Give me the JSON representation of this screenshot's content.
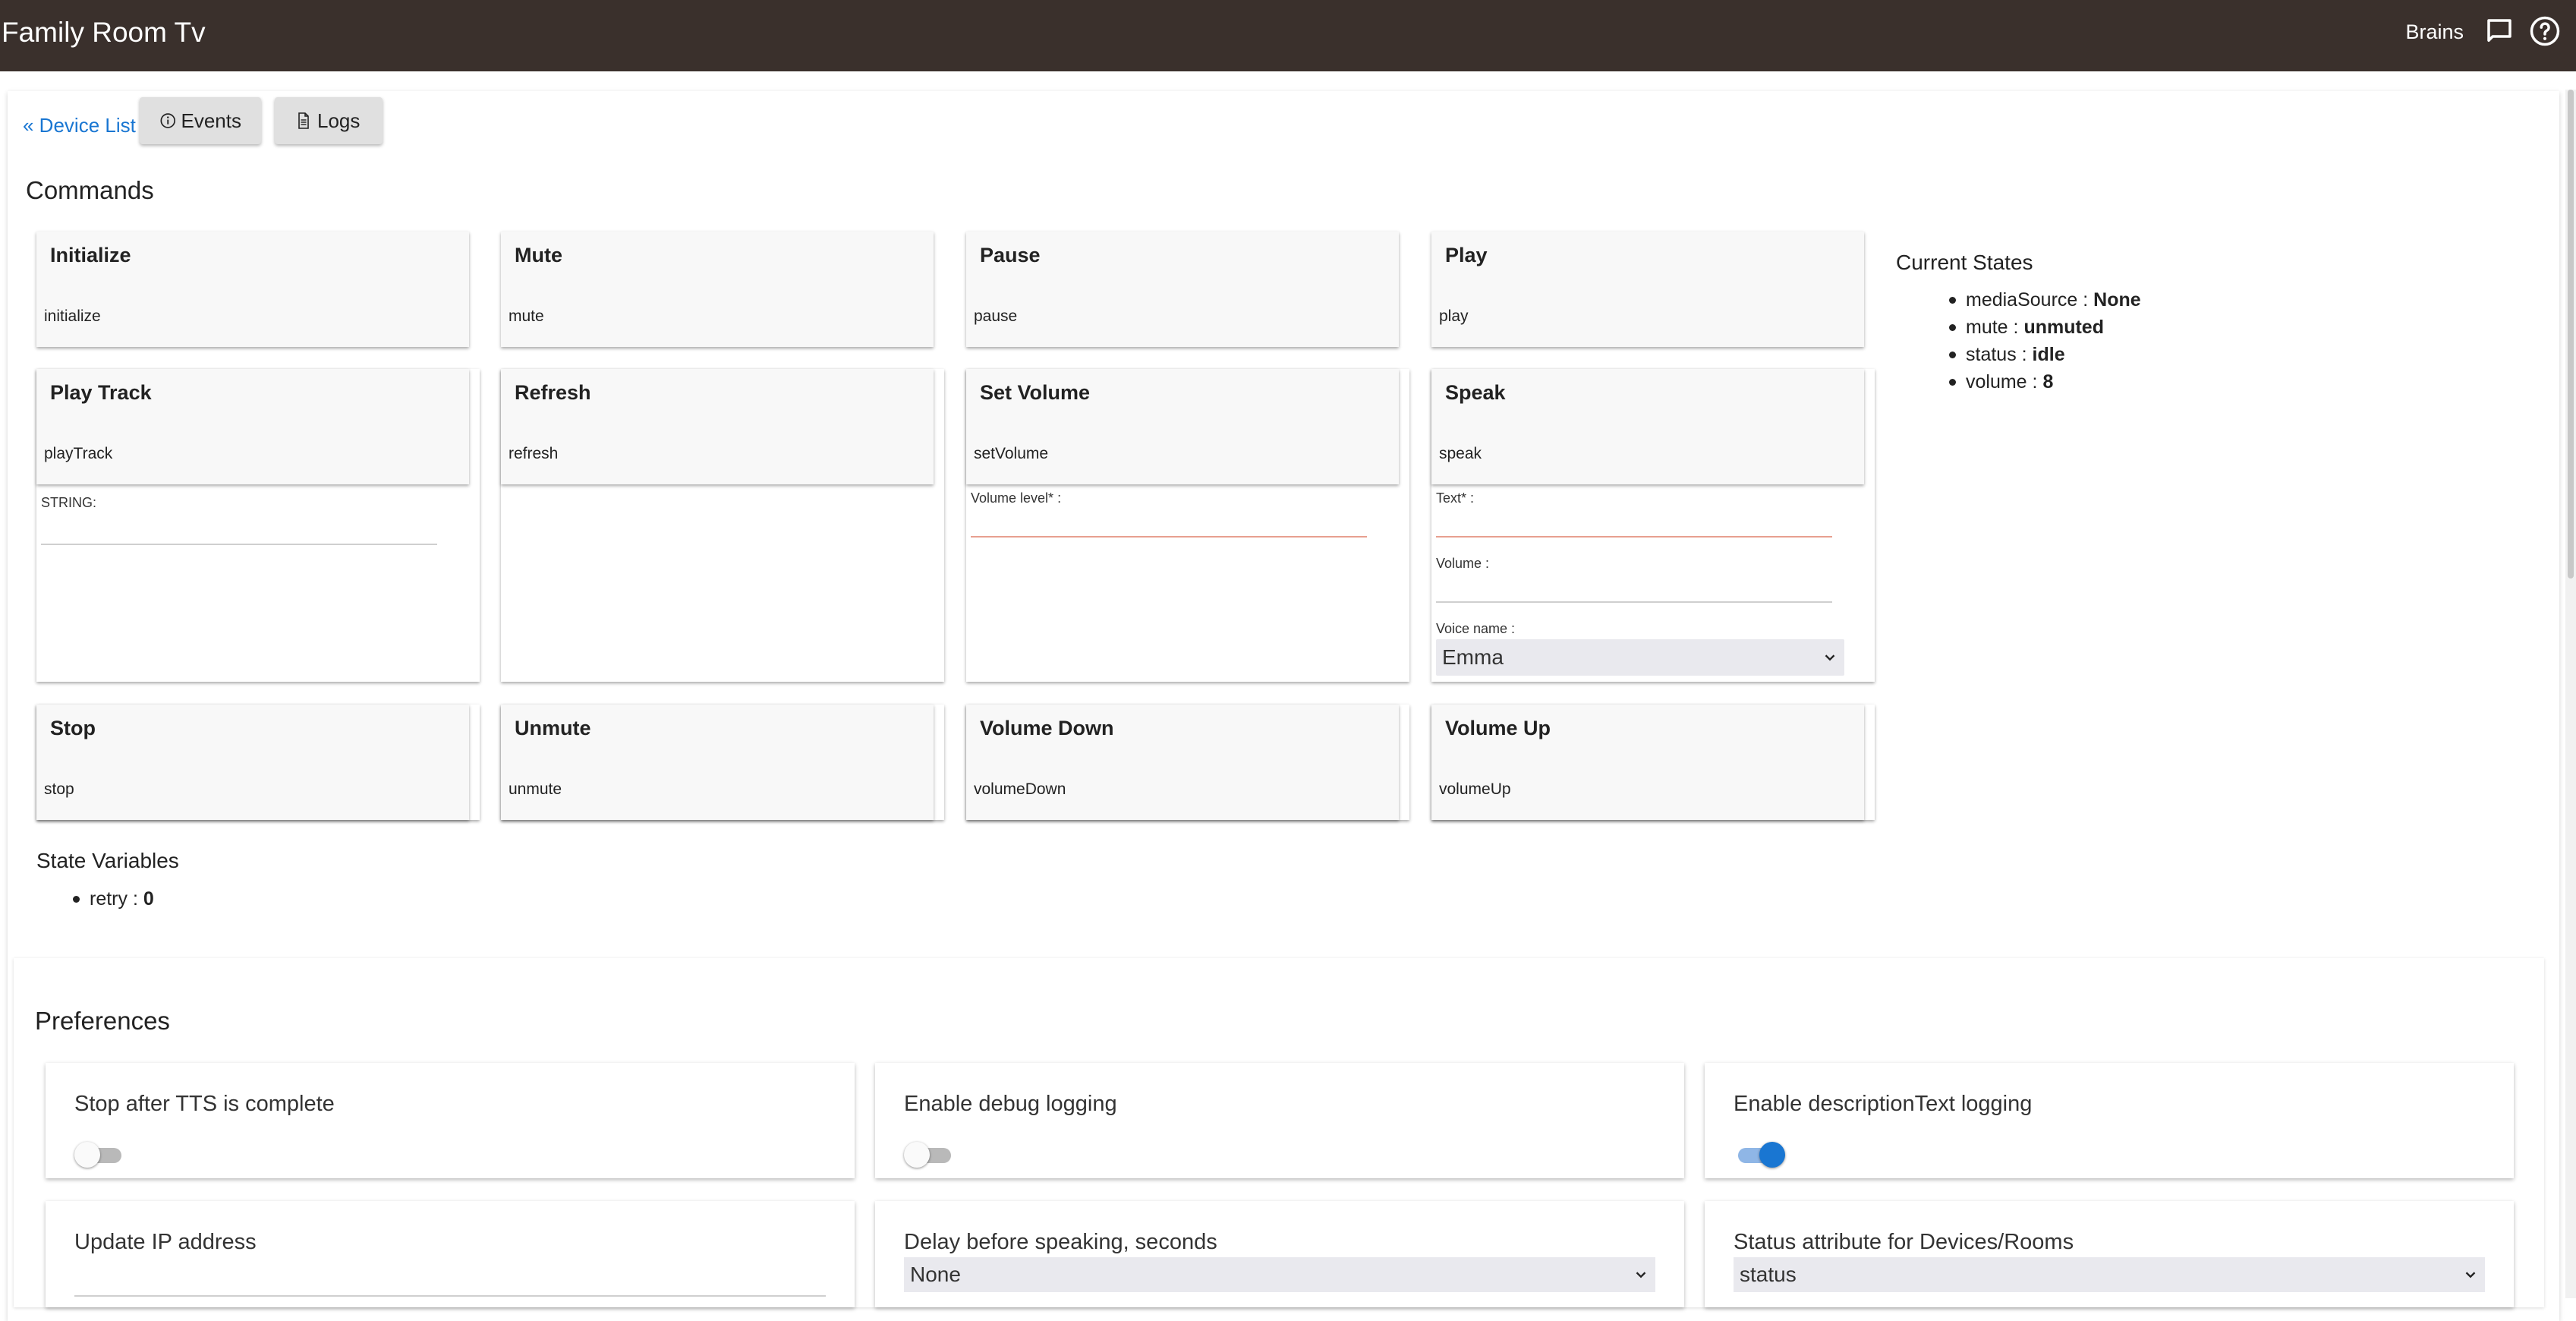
{
  "header": {
    "title": "Family Room Tv",
    "hub_name": "Brains",
    "chat_icon": "chat-bubble-icon",
    "help_icon": "help-circle-icon"
  },
  "nav": {
    "device_list": "« Device List",
    "events": "Events",
    "logs": "Logs"
  },
  "commands": {
    "title": "Commands",
    "items": [
      {
        "name": "Initialize",
        "method": "initialize"
      },
      {
        "name": "Mute",
        "method": "mute"
      },
      {
        "name": "Pause",
        "method": "pause"
      },
      {
        "name": "Play",
        "method": "play"
      },
      {
        "name": "Play Track",
        "method": "playTrack",
        "params": [
          {
            "label": "STRING:",
            "value": ""
          }
        ]
      },
      {
        "name": "Refresh",
        "method": "refresh"
      },
      {
        "name": "Set Volume",
        "method": "setVolume",
        "params": [
          {
            "label": "Volume level* :",
            "value": ""
          }
        ]
      },
      {
        "name": "Speak",
        "method": "speak",
        "params": [
          {
            "label": "Text* :",
            "value": ""
          },
          {
            "label": "Volume :",
            "value": ""
          },
          {
            "label": "Voice name :",
            "value": "Emma"
          }
        ]
      },
      {
        "name": "Stop",
        "method": "stop"
      },
      {
        "name": "Unmute",
        "method": "unmute"
      },
      {
        "name": "Volume Down",
        "method": "volumeDown"
      },
      {
        "name": "Volume Up",
        "method": "volumeUp"
      }
    ]
  },
  "current_states": {
    "title": "Current States",
    "items": [
      {
        "key": "mediaSource",
        "value": "None"
      },
      {
        "key": "mute",
        "value": "unmuted"
      },
      {
        "key": "status",
        "value": "idle"
      },
      {
        "key": "volume",
        "value": "8"
      }
    ]
  },
  "state_variables": {
    "title": "State Variables",
    "items": [
      {
        "key": "retry",
        "value": "0"
      }
    ]
  },
  "preferences": {
    "title": "Preferences",
    "items": [
      {
        "label": "Stop after TTS is complete",
        "type": "toggle",
        "on": false
      },
      {
        "label": "Enable debug logging",
        "type": "toggle",
        "on": false
      },
      {
        "label": "Enable descriptionText logging",
        "type": "toggle",
        "on": true
      },
      {
        "label": "Update IP address",
        "type": "text",
        "value": ""
      },
      {
        "label": "Delay before speaking, seconds",
        "type": "select",
        "value": "None"
      },
      {
        "label": "Status attribute for Devices/Rooms",
        "type": "select",
        "value": "status"
      }
    ]
  },
  "colors": {
    "appbar": "#3a302c",
    "link": "#1976d2",
    "toggle_on": "#1976d2"
  }
}
